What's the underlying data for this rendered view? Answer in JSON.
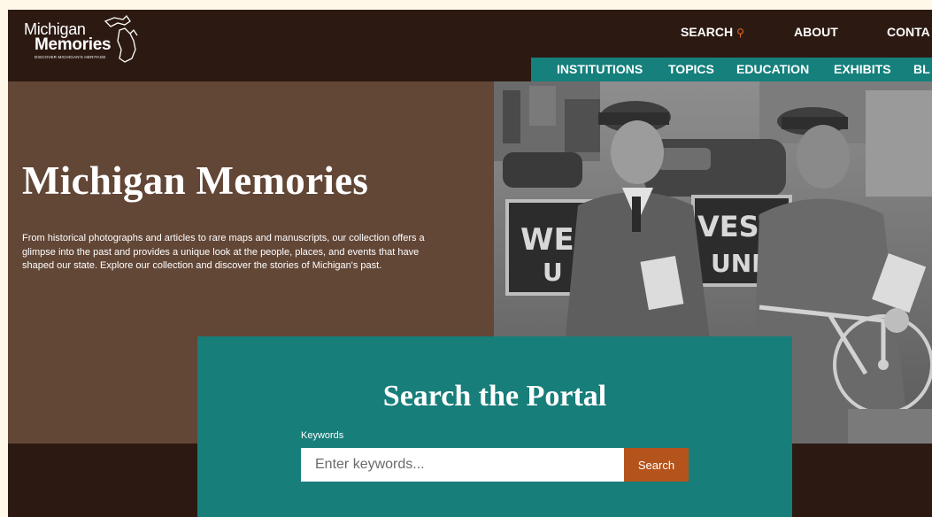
{
  "logo": {
    "line1": "Michigan",
    "line2": "Memories",
    "tagline": "DISCOVER MICHIGAN'S HERITAGE"
  },
  "top_nav": {
    "search": "SEARCH",
    "about": "ABOUT",
    "contact": "CONTA"
  },
  "sub_nav": [
    "INSTITUTIONS",
    "TOPICS",
    "EDUCATION",
    "EXHIBITS",
    "BL"
  ],
  "hero": {
    "title": "Michigan Memories",
    "description": "From historical photographs and articles to rare maps and manuscripts, our collection offers a glimpse into the past and provides a unique look at the people, places, and events that have shaped our state. Explore our collection and discover the stories of Michigan's past.",
    "photo_sign_left": "WE",
    "photo_sign_right": "VESTE",
    "photo_sign_left2": "U",
    "photo_sign_right2": "UNI"
  },
  "search_panel": {
    "title": "Search the Portal",
    "keywords_label": "Keywords",
    "placeholder": "Enter keywords...",
    "button_label": "Search"
  },
  "colors": {
    "dark_brown": "#2c1a12",
    "hero_brown": "#624636",
    "teal": "#177e7a",
    "accent_orange": "#b4541c"
  }
}
